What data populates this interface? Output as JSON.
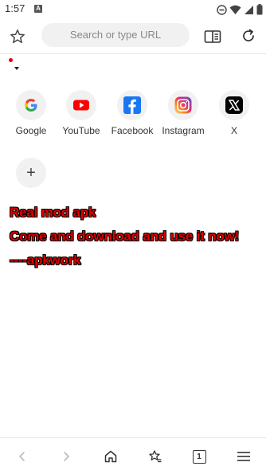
{
  "status": {
    "time": "1:57",
    "notif_letter": "A"
  },
  "toolbar": {
    "search_placeholder": "Search or type URL"
  },
  "shortcuts": [
    {
      "label": "Google",
      "icon": "google-icon"
    },
    {
      "label": "YouTube",
      "icon": "youtube-icon"
    },
    {
      "label": "Facebook",
      "icon": "facebook-icon"
    },
    {
      "label": "Instagram",
      "icon": "instagram-icon"
    },
    {
      "label": "X",
      "icon": "x-icon"
    }
  ],
  "add_shortcut_symbol": "+",
  "ad_lines": [
    "Real mod apk",
    "Come and download and use it now!",
    "----apkwork"
  ],
  "bottomnav": {
    "tab_count": "1"
  },
  "colors": {
    "ad_text": "#e00000",
    "youtube_red": "#ff0000",
    "facebook_blue": "#1877f2"
  }
}
